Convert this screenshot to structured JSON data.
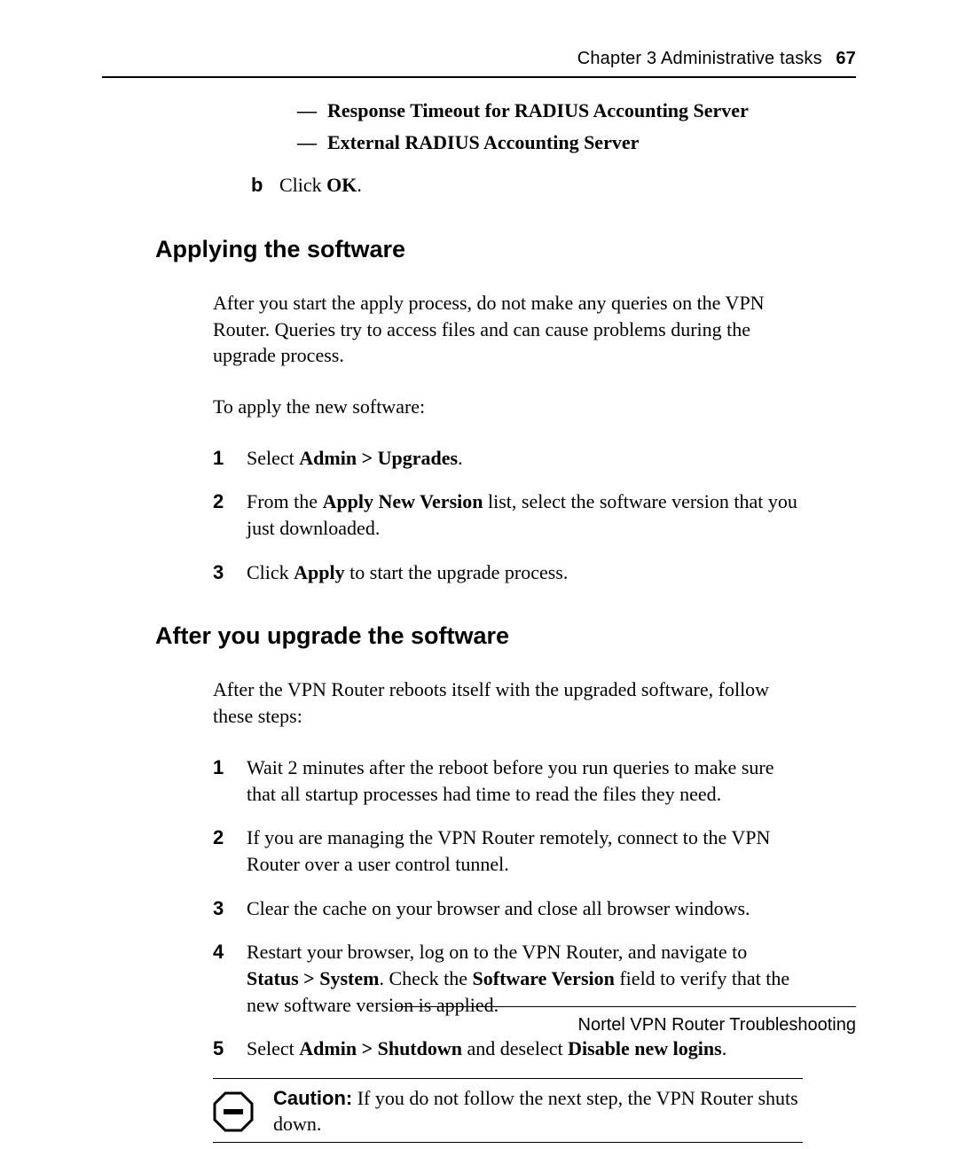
{
  "header": {
    "chapter": "Chapter 3  Administrative tasks",
    "page_num": "67"
  },
  "intro": {
    "dash_items": [
      "Response Timeout for RADIUS Accounting Server",
      "External RADIUS Accounting Server"
    ],
    "letter_b": {
      "marker": "b",
      "pre": "Click ",
      "bold": "OK",
      "post": "."
    }
  },
  "sec1": {
    "title": "Applying the software",
    "para1": "After you start the apply process, do not make any queries on the VPN Router. Queries try to access files and can cause problems during the upgrade process.",
    "para2": "To apply the new software:",
    "steps": [
      {
        "n": "1",
        "pre": "Select ",
        "b1": "Admin > Upgrades",
        "post": "."
      },
      {
        "n": "2",
        "pre": "From the ",
        "b1": "Apply New Version",
        "mid": " list, select the software version that you just downloaded."
      },
      {
        "n": "3",
        "pre": "Click ",
        "b1": "Apply",
        "mid": " to start the upgrade process."
      }
    ]
  },
  "sec2": {
    "title": "After you upgrade the software",
    "para1": "After the VPN Router reboots itself with the upgraded software, follow these steps:",
    "steps": [
      {
        "n": "1",
        "text": "Wait 2 minutes after the reboot before you run queries to make sure that all startup processes had time to read the files they need."
      },
      {
        "n": "2",
        "text": "If you are managing the VPN Router remotely, connect to the VPN Router over a user control tunnel."
      },
      {
        "n": "3",
        "text": "Clear the cache on your browser and close all browser windows."
      },
      {
        "n": "4",
        "pre": "Restart your browser, log on to the VPN Router, and navigate to ",
        "b1": "Status > System",
        "mid1": ". Check the ",
        "b2": "Software Version",
        "mid2": " field to verify that the new software version is applied."
      },
      {
        "n": "5",
        "pre": "Select ",
        "b1": "Admin > Shutdown",
        "mid1": " and deselect ",
        "b2": "Disable new logins",
        "mid2": "."
      }
    ],
    "caution": {
      "label": "Caution:",
      "text": " If you do not follow the next step, the VPN Router shuts down."
    }
  },
  "footer": "Nortel VPN Router Troubleshooting"
}
